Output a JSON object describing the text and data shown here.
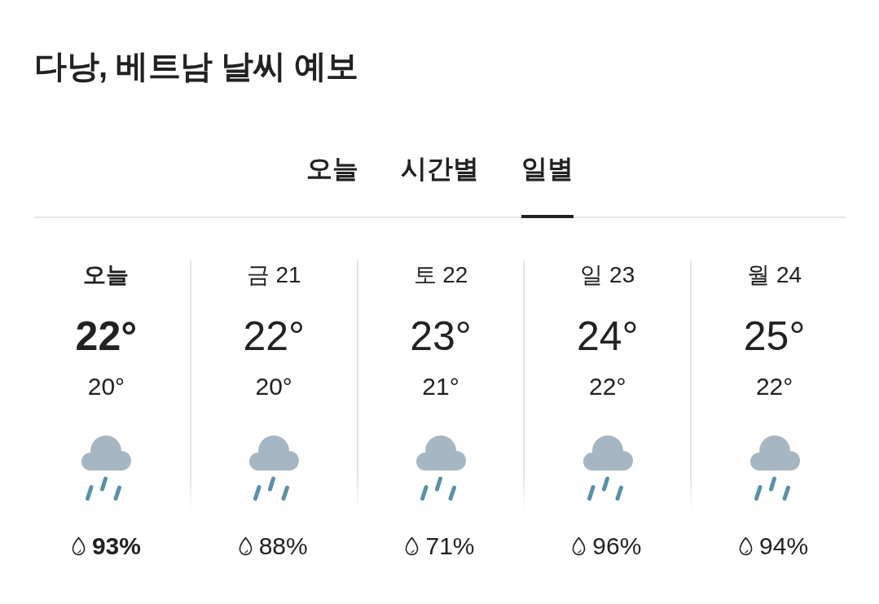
{
  "title": "다낭, 베트남 날씨 예보",
  "tabs": [
    {
      "label": "오늘",
      "selected": false
    },
    {
      "label": "시간별",
      "selected": false
    },
    {
      "label": "일별",
      "selected": true
    }
  ],
  "days": [
    {
      "day": "오늘",
      "high": "22°",
      "low": "20°",
      "precipitation": "93%",
      "selected": true
    },
    {
      "day": "금 21",
      "high": "22°",
      "low": "20°",
      "precipitation": "88%",
      "selected": false
    },
    {
      "day": "토 22",
      "high": "23°",
      "low": "21°",
      "precipitation": "71%",
      "selected": false
    },
    {
      "day": "일 23",
      "high": "24°",
      "low": "22°",
      "precipitation": "96%",
      "selected": false
    },
    {
      "day": "월 24",
      "high": "25°",
      "low": "22°",
      "precipitation": "94%",
      "selected": false
    }
  ]
}
